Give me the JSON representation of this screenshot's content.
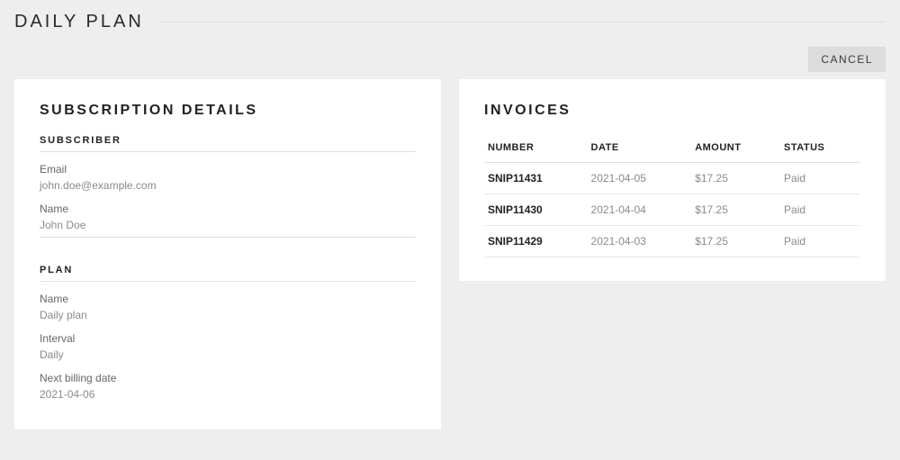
{
  "header": {
    "title": "DAILY PLAN"
  },
  "actions": {
    "cancel_label": "CANCEL"
  },
  "details": {
    "card_title": "SUBSCRIPTION DETAILS",
    "subscriber": {
      "section_label": "SUBSCRIBER",
      "email_label": "Email",
      "email_value": "john.doe@example.com",
      "name_label": "Name",
      "name_value": "John Doe"
    },
    "plan": {
      "section_label": "PLAN",
      "name_label": "Name",
      "name_value": "Daily plan",
      "interval_label": "Interval",
      "interval_value": "Daily",
      "next_billing_label": "Next billing date",
      "next_billing_value": "2021-04-06"
    }
  },
  "invoices": {
    "card_title": "INVOICES",
    "headers": {
      "number": "NUMBER",
      "date": "DATE",
      "amount": "AMOUNT",
      "status": "STATUS"
    },
    "rows": [
      {
        "number": "SNIP11431",
        "date": "2021-04-05",
        "amount": "$17.25",
        "status": "Paid"
      },
      {
        "number": "SNIP11430",
        "date": "2021-04-04",
        "amount": "$17.25",
        "status": "Paid"
      },
      {
        "number": "SNIP11429",
        "date": "2021-04-03",
        "amount": "$17.25",
        "status": "Paid"
      }
    ]
  }
}
